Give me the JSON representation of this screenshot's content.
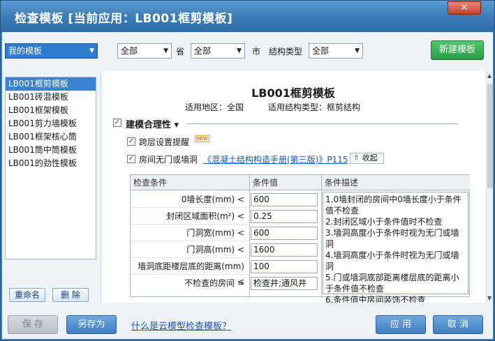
{
  "window": {
    "title": "检查模板 [当前应用：LB001框剪模板]",
    "close_label": "✕"
  },
  "filters": {
    "my_template": "我的模板",
    "province_value": "全部",
    "province_label": "省",
    "city_value": "全部",
    "city_label": "市",
    "structure_label": "结构类型",
    "structure_value": "全部",
    "new_template_button": "新建模板"
  },
  "template_list": [
    "LB001框剪模板",
    "LB001砖混模板",
    "LB001框架模板",
    "LB001剪力墙模板",
    "LB001框架核心筒",
    "LB001筒中筒模板",
    "LB001的劲性模板"
  ],
  "list_buttons": {
    "rename": "重命名",
    "delete": "删 除"
  },
  "detail": {
    "name": "LB001框剪模板",
    "region": "适用地区：全国",
    "structure_type": "适用结构类型：框剪结构",
    "section_title": "建模合理性",
    "section_arrow": "▾",
    "opt1_label": "跨层设置提醒",
    "new_badge": "NEW",
    "opt2_label": "房间无门或墙洞",
    "opt2_link": "《混凝土结构构造手册(第三版)》P115",
    "collapse_label": "收起",
    "collapse_icon": "⇑"
  },
  "table": {
    "headers": [
      "检查条件",
      "条件值",
      "条件描述"
    ],
    "rows": [
      {
        "condition": "0墙长度(mm) <",
        "value": "600"
      },
      {
        "condition": "封闭区域面积(m²) <",
        "value": "0.25"
      },
      {
        "condition": "门洞宽(mm) <",
        "value": "600"
      },
      {
        "condition": "门洞高(mm) <",
        "value": "1600"
      },
      {
        "condition": "墙洞底距楼层底的距离(mm) <",
        "value": "100"
      },
      {
        "condition": "不检查的房间 =",
        "value": "检查井;通风井"
      }
    ],
    "description": "1.0墙封闭的房间中0墙长度小于条件值不检查\n2.封闭区域小于条件值时不检查\n3.墙洞高度小于条件时视为无门或墙洞\n4.墙洞高度小于条件时视为无门或墙洞\n5.门或墙洞底部距离楼层底的距离小于条件值不检查\n6.条件值中房间装饰不检查"
  },
  "footer": {
    "save": "保 存",
    "save_as": "另存为",
    "help_link": "什么是云模型检查模板？",
    "apply": "应 用",
    "cancel": "取 消"
  },
  "colors": {
    "title_bar": "#3a7bb5",
    "accent_green": "#2c9a45",
    "selection": "#3b83d1"
  }
}
